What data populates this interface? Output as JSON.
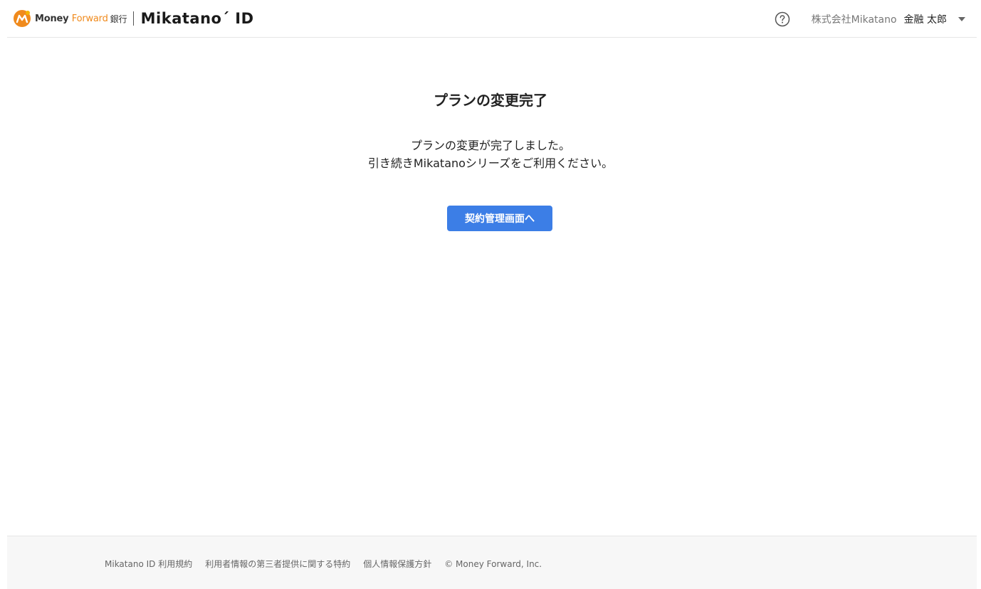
{
  "header": {
    "brand_word1": "Money",
    "brand_word2": "Forward",
    "bank_label": "銀行",
    "product_name": "Mikatano´ ID",
    "company_name": "株式会社Mikatano",
    "user_name": "金融 太郎",
    "help_icon": "question-circle-icon",
    "menu_icon": "caret-down-icon"
  },
  "main": {
    "title": "プランの変更完了",
    "message_line1": "プランの変更が完了しました。",
    "message_line2": "引き続きMikatanoシリーズをご利用ください。",
    "button_label": "契約管理画面へ"
  },
  "footer": {
    "links": [
      {
        "label": "Mikatano ID 利用規約"
      },
      {
        "label": "利用者情報の第三者提供に関する特約"
      },
      {
        "label": "個人情報保護方針"
      }
    ],
    "copyright": "© Money Forward, Inc."
  },
  "colors": {
    "primary": "#3c7ee6",
    "brand_orange": "#f08a1c",
    "footer_bg": "#f7f7f7"
  }
}
